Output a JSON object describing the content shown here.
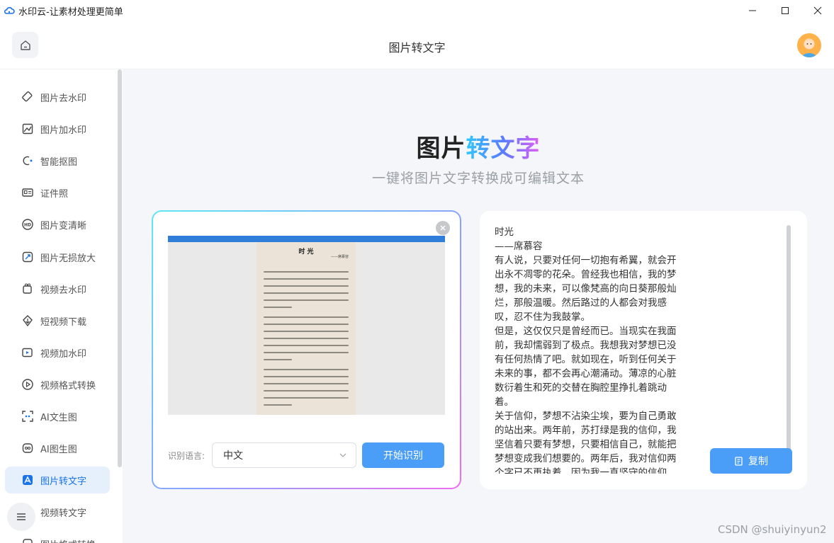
{
  "window": {
    "app_title": "水印云-让素材处理更简单"
  },
  "header": {
    "page_title": "图片转文字"
  },
  "sidebar": {
    "items": [
      {
        "label": "图片去水印",
        "icon": "eraser-icon",
        "active": false
      },
      {
        "label": "图片加水印",
        "icon": "image-add-icon",
        "active": false
      },
      {
        "label": "智能抠图",
        "icon": "cutout-icon",
        "active": false
      },
      {
        "label": "证件照",
        "icon": "id-card-icon",
        "active": false
      },
      {
        "label": "图片变清晰",
        "icon": "hd-icon",
        "active": false
      },
      {
        "label": "图片无损放大",
        "icon": "enlarge-icon",
        "active": false
      },
      {
        "label": "视频去水印",
        "icon": "video-eraser-icon",
        "active": false
      },
      {
        "label": "短视频下载",
        "icon": "download-icon",
        "active": false
      },
      {
        "label": "视频加水印",
        "icon": "video-add-icon",
        "active": false
      },
      {
        "label": "视频格式转换",
        "icon": "play-circle-icon",
        "active": false
      },
      {
        "label": "AI文生图",
        "icon": "ai-text-image-icon",
        "active": false
      },
      {
        "label": "AI图生图",
        "icon": "ai-image-image-icon",
        "active": false
      },
      {
        "label": "图片转文字",
        "icon": "image-text-icon",
        "active": true
      },
      {
        "label": "视频转文字",
        "icon": "menu-icon",
        "active": false
      },
      {
        "label": "图片格式转换",
        "icon": "format-icon",
        "active": false
      }
    ]
  },
  "hero": {
    "title_part1": "图片",
    "title_part2": "转文字",
    "subtitle": "一键将图片文字转换成可编辑文本"
  },
  "preview": {
    "title": "时 光",
    "author": "——席慕容"
  },
  "controls": {
    "language_label": "识别语言:",
    "language_value": "中文",
    "start_button": "开始识别"
  },
  "result": {
    "lines": [
      "时光",
      "——席慕容",
      "有人说，只要对任何一切抱有希翼，就会开出永不凋零的花朵。曾经我也相信，我的梦想，我的未来，可以像梵高的向日葵那般灿烂，那般温暖。然后路过的人都会对我感叹，忍不住为我鼓掌。",
      "但是，这仅仅只是曾经而已。当现实在我面前，我却懦弱到了极点。我想我对梦想已没有任何热情了吧。就如现在，听到任何关于未来的事，都不会再心潮涌动。薄凉的心脏数衍着生和死的交替在胸腔里挣扎着跳动着。",
      "关于信仰，梦想不沾染尘埃，要为自己勇敢的站出来。两年前，苏打绿是我的信仰，我坚信着只要有梦想，只要相信自己，就能把梦想变成我们想要的。两年后，我对信仰两个字已不再执着，因为我一直坚守的信仰"
    ],
    "copy_button": "复制"
  },
  "watermark": "CSDN @shuiyinyun2",
  "colors": {
    "accent": "#4a9ef7",
    "active_bg": "#e6f0fc",
    "active_text": "#1a73e8"
  }
}
